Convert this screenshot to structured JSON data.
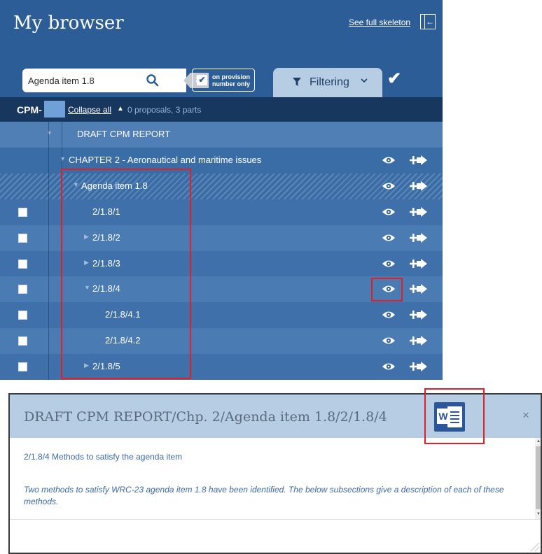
{
  "browser": {
    "title": "My browser",
    "see_full_skeleton": "See full skeleton",
    "search": {
      "value": "Agenda item 1.8",
      "clear_label": "×"
    },
    "provision": {
      "checked": true,
      "check_glyph": "✔",
      "label": "on provision number only"
    },
    "filter": {
      "label": "Filtering",
      "icon": "funnel-icon",
      "chevron": "⌵"
    },
    "confirm": "✔",
    "cpm": {
      "label": "CPM-",
      "collapse_all": "Collapse all",
      "collapse_arrow": "▲",
      "summary": "0 proposals, 3 parts"
    },
    "rows": [
      {
        "label": "DRAFT CPM REPORT",
        "caret": "▼",
        "checkbox": false,
        "actions": false,
        "bg": "#4f7fb5"
      },
      {
        "label": "CHAPTER 2 - Aeronautical and maritime issues",
        "caret": "▼",
        "checkbox": false,
        "actions": true,
        "bg": "#3a6ca6"
      },
      {
        "label": "Agenda item 1.8",
        "caret": "▼",
        "checkbox": false,
        "actions": true,
        "bg": "hatch"
      },
      {
        "label": "2/1.8/1",
        "caret": "",
        "checkbox": true,
        "actions": true,
        "bg": "#3f70aa"
      },
      {
        "label": "2/1.8/2",
        "caret": "▶",
        "checkbox": true,
        "actions": true,
        "bg": "#4a7bb3"
      },
      {
        "label": "2/1.8/3",
        "caret": "▶",
        "checkbox": true,
        "actions": true,
        "bg": "#3f70aa"
      },
      {
        "label": "2/1.8/4",
        "caret": "▼",
        "checkbox": true,
        "actions": true,
        "bg": "#4a7bb3"
      },
      {
        "label": "2/1.8/4.1",
        "caret": "",
        "checkbox": true,
        "actions": true,
        "bg": "#3f70aa"
      },
      {
        "label": "2/1.8/4.2",
        "caret": "",
        "checkbox": true,
        "actions": true,
        "bg": "#4a7bb3"
      },
      {
        "label": "2/1.8/5",
        "caret": "▶",
        "checkbox": true,
        "actions": true,
        "bg": "#3f70aa"
      }
    ],
    "icons": {
      "eye": "eye-icon",
      "add_to_basket": "add-arrow-icon"
    }
  },
  "modal": {
    "title": "DRAFT CPM REPORT/Chp. 2/Agenda item 1.8/2/1.8/4",
    "word_letter": "W",
    "close": "×",
    "section_title": "2/1.8/4   Methods to satisfy the agenda item",
    "section_description": "Two methods to satisfy WRC-23 agenda item 1.8 have been identified. The below subsections give a description of each of these methods."
  },
  "colors": {
    "panel_bg": "#2c5d96",
    "cpm_bar": "#18375f",
    "filter_tab": "#b7cde4",
    "highlight": "#e01f26",
    "word_blue": "#2b579a",
    "modal_text": "#3a6aa8"
  }
}
